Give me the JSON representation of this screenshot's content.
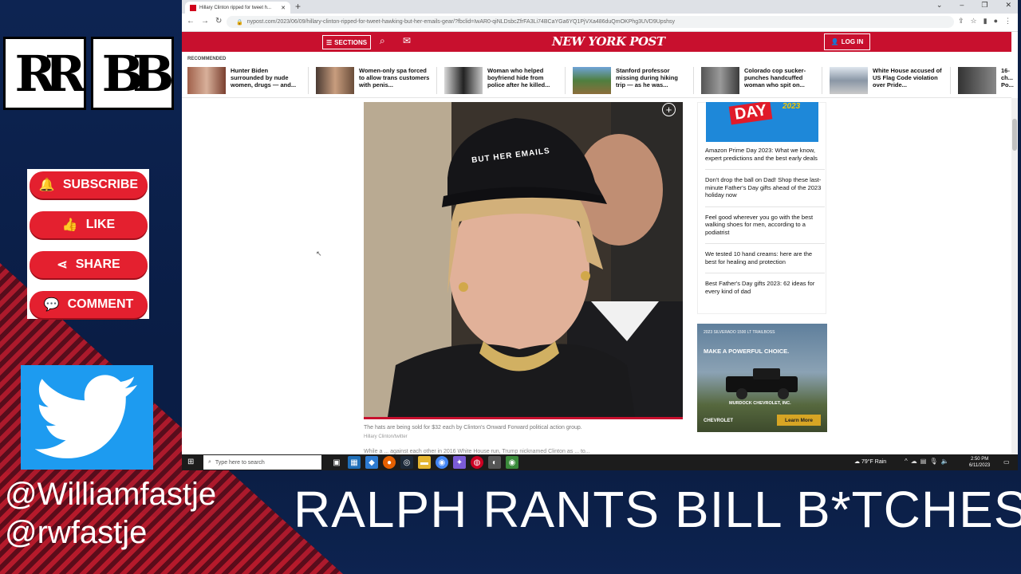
{
  "overlay": {
    "logo_left": "RR",
    "logo_right": "BB",
    "social_buttons": [
      {
        "label": "SUBSCRIBE",
        "icon": "bell-icon"
      },
      {
        "label": "LIKE",
        "icon": "thumbs-up-icon"
      },
      {
        "label": "SHARE",
        "icon": "share-icon"
      },
      {
        "label": "COMMENT",
        "icon": "comment-icon"
      }
    ],
    "twitter_icon": "twitter-bird-icon",
    "handle_1": "@Williamfastje",
    "handle_2": "@rwfastje",
    "banner": "RALPH RANTS BILL B*TCHES",
    "accent": "#e4202f",
    "twitter_color": "#1d9bf0"
  },
  "browser": {
    "tab_title": "Hillary Clinton ripped for tweet h...",
    "url": "nypost.com/2023/06/09/hillary-clinton-ripped-for-tweet-hawking-but-her-emails-gear/?fbclid=IwAR0-qiNLDsbcZfrFA3Li74BCaYGa6YQ1PjVXa486duQmOKPhg3UVD9Upshsy"
  },
  "nypost": {
    "sections_label": "SECTIONS",
    "logo": "NEW YORK POST",
    "login_label": "LOG IN",
    "brand_color": "#c8102e",
    "recommended_label": "RECOMMENDED",
    "recommended": [
      {
        "text": "Hunter Biden surrounded by nude women, drugs — and..."
      },
      {
        "text": "Women-only spa forced to allow trans customers with penis..."
      },
      {
        "text": "Woman who helped boyfriend hide from police after he killed..."
      },
      {
        "text": "Stanford professor missing during hiking trip — as he was..."
      },
      {
        "text": "Colorado cop sucker-punches handcuffed woman who spit on..."
      },
      {
        "text": "White House accused of US Flag Code violation over Pride..."
      },
      {
        "text": "16-ch... Po..."
      }
    ],
    "photo": {
      "hat_text": "BUT HER EMAILS",
      "caption": "The hats are being sold for $32 each by Clinton's Onward Forward political action group.",
      "credit": "Hillary Clinton/twitter"
    },
    "body_text_partial": "While a ... against each other in 2016 White House run, Trump nicknamed Clinton as ... to...",
    "sidebar": {
      "promo_text": "DAY",
      "promo_year": "2023",
      "links": [
        "Amazon Prime Day 2023: What we know, expert predictions and the best early deals",
        "Don't drop the ball on Dad! Shop these last-minute Father's Day gifts ahead of the 2023 holiday now",
        "Feel good wherever you go with the best walking shoes for men, according to a podiatrist",
        "We tested 10 hand creams: here are the best for healing and protection",
        "Best Father's Day gifts 2023: 62 ideas for every kind of dad"
      ]
    },
    "ad": {
      "top_text": "2023 SILVERADO 1500 LT TRAILBOSS",
      "headline": "MAKE A POWERFUL CHOICE.",
      "dealer": "MURDOCK CHEVROLET, INC.",
      "brand": "CHEVROLET",
      "button": "Learn More"
    }
  },
  "taskbar": {
    "search_placeholder": "Type here to search",
    "weather": "79°F Rain",
    "time": "2:50 PM",
    "date": "6/11/2023"
  }
}
